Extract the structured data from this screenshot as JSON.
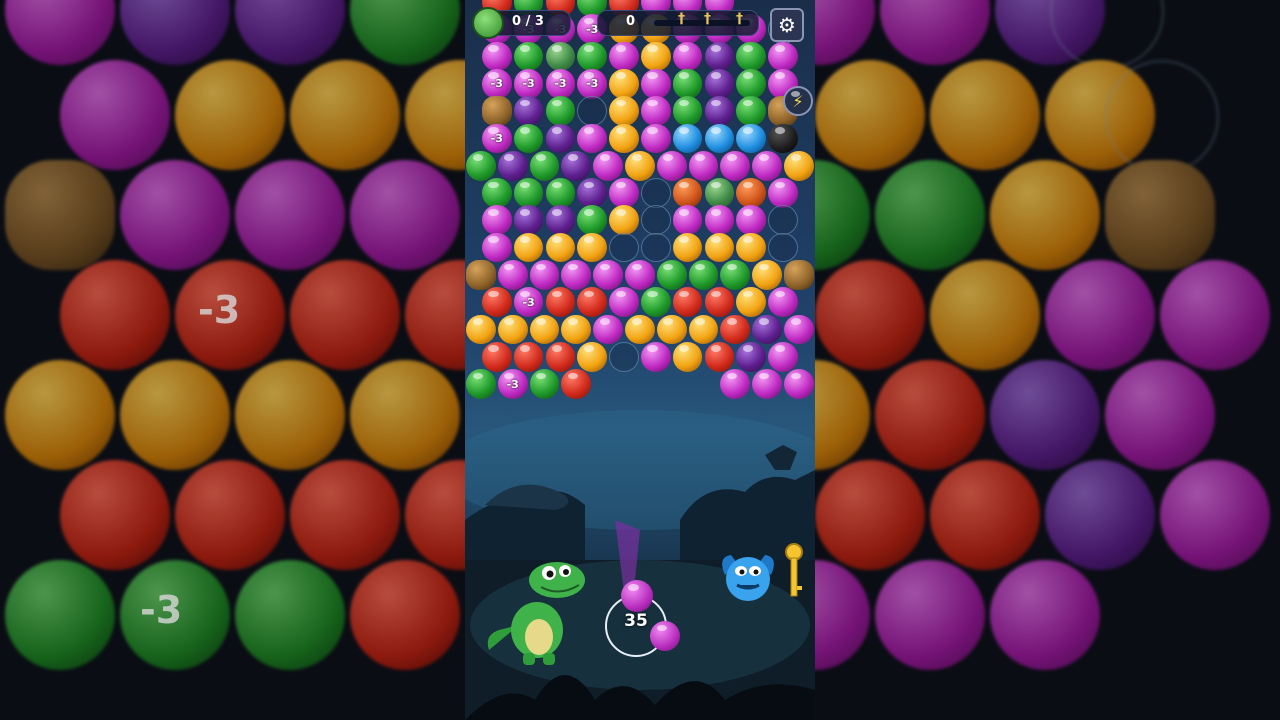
{
  "hud": {
    "frog_progress": "0 / 3",
    "score": "0",
    "settings_icon": "gear-icon",
    "frog_icon": "frog-icon"
  },
  "launcher": {
    "shots_left": "35",
    "current_color": "#b72cbd",
    "next_color": "#b72cbd"
  },
  "characters": [
    "green-dinosaur-icon",
    "blue-monster-icon",
    "golden-key-icon"
  ],
  "powerups": [
    "lightning-icon",
    "bomb-icon"
  ],
  "marks": {
    "countdown": "-3"
  },
  "colors": {
    "R": "#d22b1c",
    "G": "#1f9a2a",
    "Y": "#f2a312",
    "M": "#c02ac3",
    "P": "#5e1f8e",
    "B": "#1f8fe0",
    "accent": "#ffffff"
  },
  "grid_rows": [
    "RGRGRMMM",
    "QQQQYYMMMX",
    "MGFGMYMPGM",
    "QQQQYMGPGM",
    "KPGXYMGPGK",
    "QGPMYMBBBO",
    "GPGPMYMMMMY",
    "GGGPMXVFVM",
    "MPPGYXMMMX",
    "MYYYXXYYYX",
    "KMMMMMGGGYK",
    "RQRRMGRRYM",
    "YYYYMYYYRPM",
    "RRRYXMYRPM",
    "GQGR....MMMM"
  ],
  "grid_legend": {
    "R": "red-bubble",
    "G": "green-bubble",
    "Y": "yellow-bubble",
    "M": "magenta-bubble",
    "P": "purple-bubble",
    "B": "blue-crystal-bubble",
    "Q": "countdown-bubble",
    "X": "empty-slot",
    "F": "frog-bubble",
    "K": "rock-bubble",
    "V": "orange-gem-bubble",
    "O": "bomb-bubble"
  }
}
